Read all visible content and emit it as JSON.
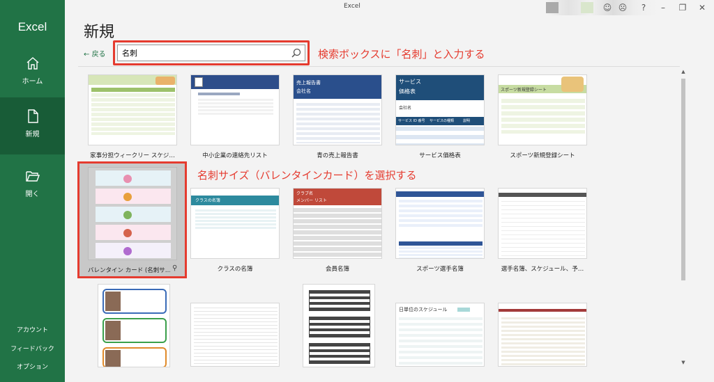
{
  "window": {
    "title": "Excel"
  },
  "sidebar": {
    "app_name": "Excel",
    "items": [
      {
        "label": "ホーム",
        "icon": "home-icon"
      },
      {
        "label": "新規",
        "icon": "new-file-icon",
        "active": true
      },
      {
        "label": "開く",
        "icon": "folder-open-icon"
      }
    ],
    "footer": [
      "アカウント",
      "フィードバック",
      "オプション"
    ]
  },
  "main": {
    "heading": "新規",
    "back_label": "戻る",
    "search": {
      "value": "名刺",
      "placeholder": ""
    }
  },
  "annotations": {
    "search_note": "検索ボックスに「名刺」と入力する",
    "select_note": "名刺サイズ（バレンタインカード）を選択する"
  },
  "templates": {
    "row1": [
      {
        "name": "家事分担ウィークリー スケジ…"
      },
      {
        "name": "中小企業の連絡先リスト"
      },
      {
        "name": "青の売上報告書"
      },
      {
        "name": "サービス価格表"
      },
      {
        "name": "スポーツ新規登録シート"
      }
    ],
    "row2": [
      {
        "name": "バレンタイン カード (名刺サ…"
      },
      {
        "name": "クラスの名簿"
      },
      {
        "name": "会員名簿"
      },
      {
        "name": "スポーツ選手名簿"
      },
      {
        "name": "選手名簿、スケジュール、予…"
      }
    ],
    "row3_count": 5
  },
  "thumb_text": {
    "sales_title": "売上報告書",
    "company": "会社名",
    "service_title": "サービス",
    "price_list": "価格表",
    "company_name": "会社名",
    "svc_rows": [
      "サービス ID 番号",
      "サービスの種類",
      "説明"
    ],
    "club": "クラブ名",
    "member_list": "メンバー リスト",
    "schedule": "日単位のスケジュール",
    "sports_reg": "スポーツ新規登録シート",
    "class_roster": "クラスの名簿"
  },
  "colors": {
    "sidebar": "#217346",
    "sidebar_active": "#185c37",
    "highlight": "#e53b2f"
  }
}
